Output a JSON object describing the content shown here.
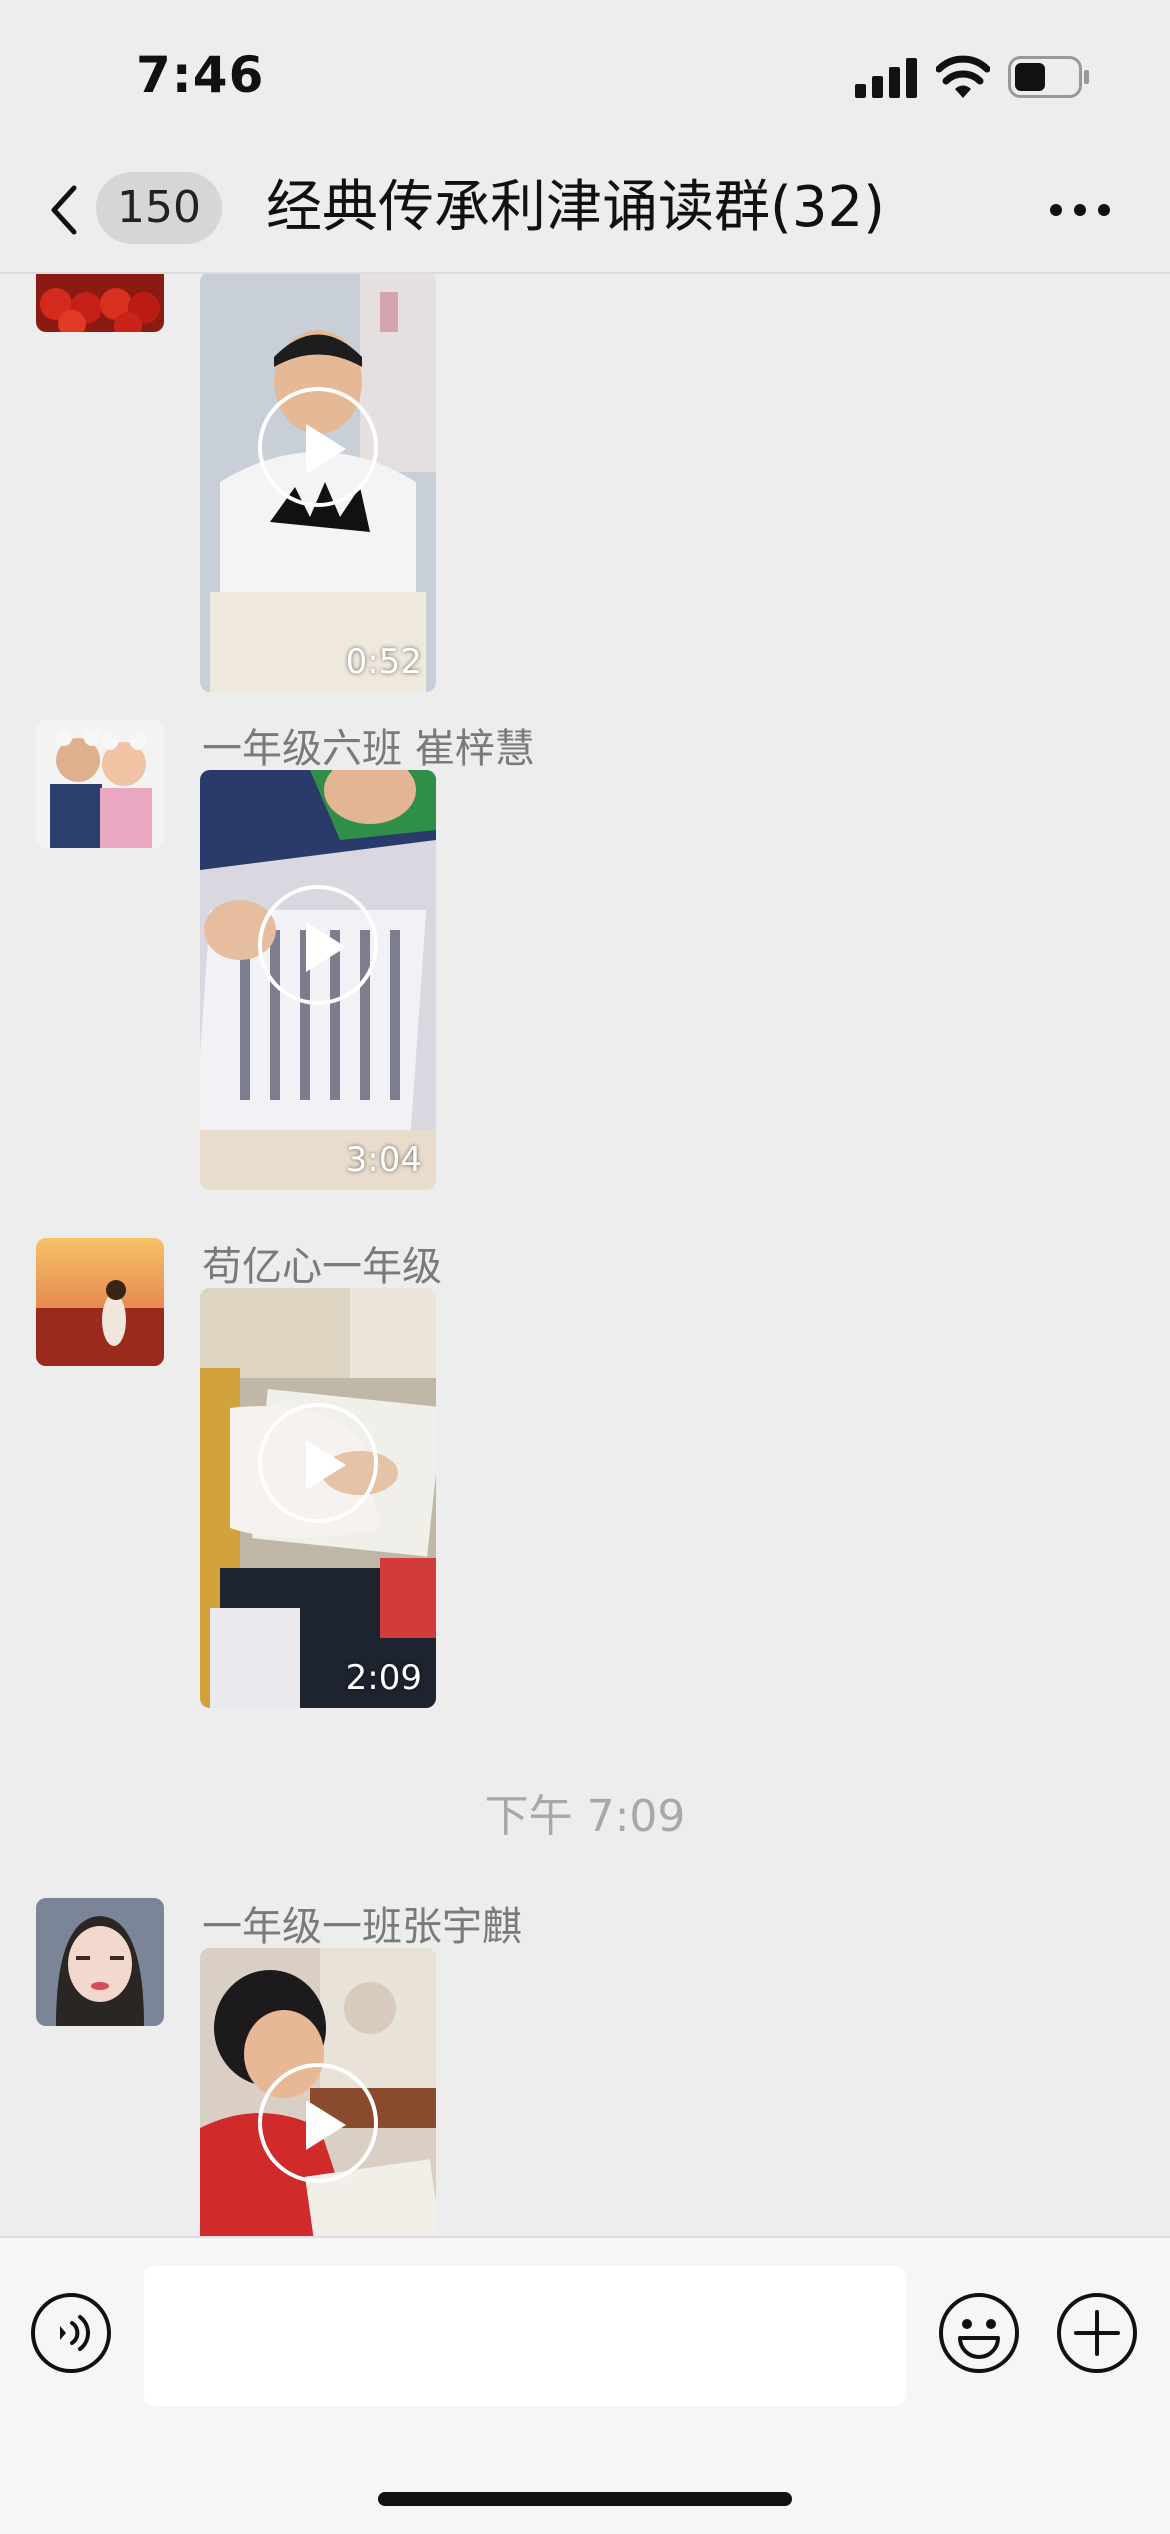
{
  "status_bar": {
    "time": "7:46"
  },
  "nav": {
    "unread_count": "150",
    "title": "经典传承利津诵读群(32)"
  },
  "messages": [
    {
      "sender": "",
      "duration": "0:52"
    },
    {
      "sender": "一年级六班  崔梓慧",
      "duration": "3:04"
    },
    {
      "sender": "苟亿心一年级",
      "duration": "2:09"
    },
    {
      "timestamp": "下午 7:09"
    },
    {
      "sender": "一年级一班张宇麒",
      "duration": ""
    }
  ],
  "input": {
    "placeholder": "",
    "value": ""
  },
  "icons": {
    "back": "chevron-left-icon",
    "more": "more-dots-icon",
    "voice": "voice-icon",
    "emoji": "emoji-icon",
    "plus": "plus-icon"
  }
}
